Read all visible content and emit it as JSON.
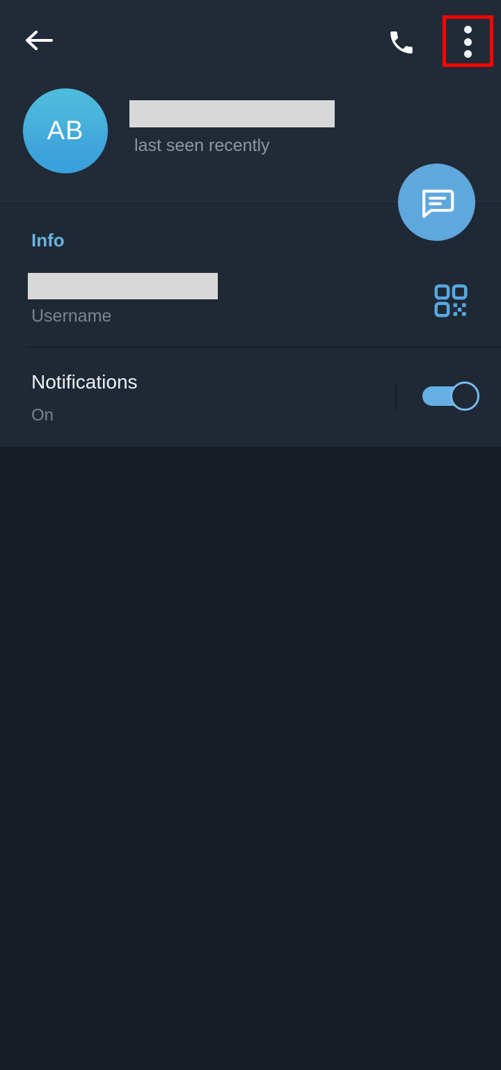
{
  "app": {
    "theme": "dark",
    "background_color": "#161d26",
    "card_color": "#1f2935",
    "header_color": "#212b38",
    "accent_color": "#6ab3e0",
    "highlight_color": "#fe0000"
  },
  "appbar": {
    "back_label": "Back",
    "back_icon": "arrow-left-icon",
    "call_label": "Call",
    "call_icon": "phone-icon",
    "menu_label": "More options",
    "menu_icon": "overflow-menu-icon",
    "highlighted_element": "overflow-menu-button"
  },
  "profile": {
    "avatar_initials": "AB",
    "avatar_label": "Contact avatar",
    "name": "",
    "name_redacted": true,
    "status": "last seen recently",
    "message_button_label": "Message",
    "message_icon": "chat-bubble-icon"
  },
  "info": {
    "section_title": "Info",
    "username_value": "",
    "username_redacted": true,
    "username_label": "Username",
    "qr_label": "QR code",
    "qr_icon": "qr-code-icon"
  },
  "notifications": {
    "title": "Notifications",
    "state": "On",
    "toggle_on": true,
    "toggle_label": "Notifications toggle"
  }
}
